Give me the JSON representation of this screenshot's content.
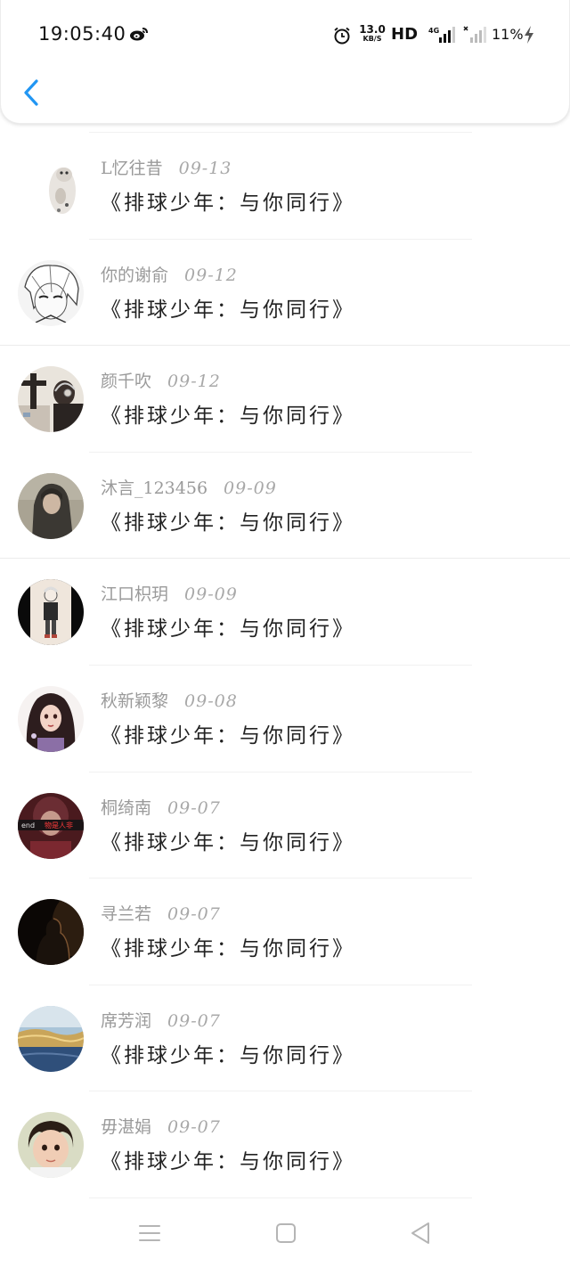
{
  "status_bar": {
    "time": "19:05:40",
    "network_speed": "13.0",
    "network_speed_unit": "KB/S",
    "hd_label": "HD",
    "network_type": "4G",
    "battery": "11%",
    "icons": [
      "weibo-icon",
      "alarm-icon",
      "signal-icon",
      "battery-charging-icon"
    ]
  },
  "header": {
    "back_icon": "chevron-left-icon",
    "accent_color": "#2196f3"
  },
  "comments": [
    {
      "name": "L忆往昔",
      "date": "09-13",
      "text": "《排球少年：与你同行》",
      "avatar": "cat"
    },
    {
      "name": "你的谢俞",
      "date": "09-12",
      "text": "《排球少年：与你同行》",
      "avatar": "anime-sketch"
    },
    {
      "name": "颜千吹",
      "date": "09-12",
      "text": "《排球少年：与你同行》",
      "avatar": "headphones"
    },
    {
      "name": "沐言_123456",
      "date": "09-09",
      "text": "《排球少年：与你同行》",
      "avatar": "hoodie"
    },
    {
      "name": "江口枳玥",
      "date": "09-09",
      "text": "《排球少年：与你同行》",
      "avatar": "anime-figure"
    },
    {
      "name": "秋新颖黎",
      "date": "09-08",
      "text": "《排球少年：与你同行》",
      "avatar": "anime-girl"
    },
    {
      "name": "桐绮南",
      "date": "09-07",
      "text": "《排球少年：与你同行》",
      "avatar": "red-text"
    },
    {
      "name": "寻兰若",
      "date": "09-07",
      "text": "《排球少年：与你同行》",
      "avatar": "dark-silhouette"
    },
    {
      "name": "席芳润",
      "date": "09-07",
      "text": "《排球少年：与你同行》",
      "avatar": "landscape"
    },
    {
      "name": "毋湛娟",
      "date": "09-07",
      "text": "《排球少年：与你同行》",
      "avatar": "child"
    }
  ],
  "avatar_texts": {
    "red_text_left": "end",
    "red_text_right": "物是人非"
  },
  "nav": {
    "icons": [
      "menu-icon",
      "home-icon",
      "back-triangle-icon"
    ]
  }
}
